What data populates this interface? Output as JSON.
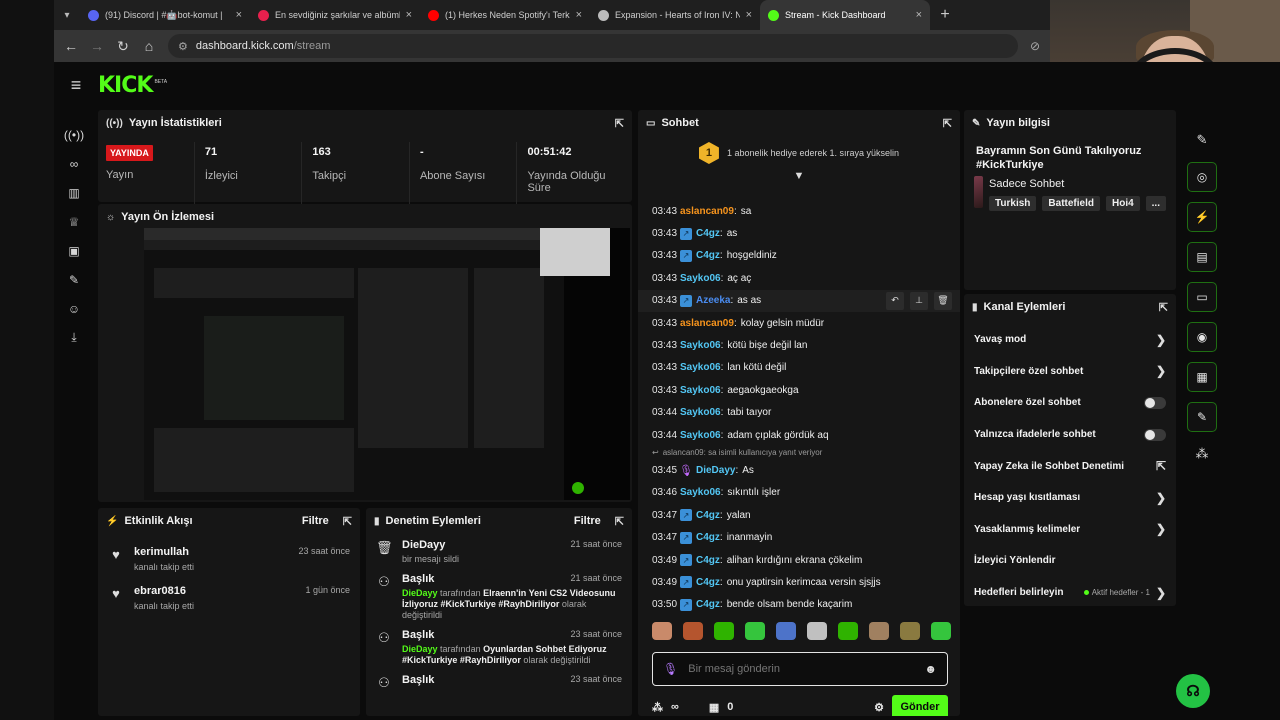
{
  "browser": {
    "tabs": [
      {
        "label": "(91) Discord | #🤖bot-komut | ",
        "color": "#5865f2",
        "active": false
      },
      {
        "label": "En sevdiğiniz şarkılar ve albümle",
        "color": "#e8204d",
        "active": false
      },
      {
        "label": "(1) Herkes Neden Spotify'ı Terk",
        "color": "#ff0000",
        "active": false
      },
      {
        "label": "Expansion - Hearts of Iron IV: N",
        "color": "#bbbbbb",
        "active": false
      },
      {
        "label": "Stream - Kick Dashboard",
        "color": "#53fc18",
        "active": true
      }
    ],
    "url_host": "dashboard.kick.com",
    "url_path": "/stream"
  },
  "app": {
    "logo": "KICK",
    "logo_badge": "BETA"
  },
  "stats_panel": {
    "title": "Yayın İstatistikleri",
    "live_badge": "YAYINDA",
    "items": [
      {
        "value": "",
        "label": "Yayın"
      },
      {
        "value": "71",
        "label": "İzleyici"
      },
      {
        "value": "163",
        "label": "Takipçi"
      },
      {
        "value": "-",
        "label": "Abone Sayısı"
      },
      {
        "value": "00:51:42",
        "label": "Yayında Olduğu Süre"
      }
    ]
  },
  "preview_panel": {
    "title": "Yayın Ön İzlemesi"
  },
  "activity_panel": {
    "title": "Etkinlik Akışı",
    "filter": "Filtre",
    "items": [
      {
        "name": "kerimullah",
        "time": "23 saat önce",
        "desc": "kanalı takip etti"
      },
      {
        "name": "ebrar0816",
        "time": "1 gün önce",
        "desc": "kanalı takip etti"
      }
    ]
  },
  "mod_panel": {
    "title": "Denetim Eylemleri",
    "filter": "Filtre",
    "items": [
      {
        "name": "DieDayy",
        "time": "21 saat önce",
        "desc": "bir mesajı sildi",
        "actor": "",
        "by": "",
        "value": "",
        "tail": ""
      },
      {
        "name": "Başlık",
        "time": "21 saat önce",
        "desc": "",
        "actor": "DieDayy",
        "by": "tarafından",
        "value": "Elraenn'in Yeni CS2 Videosunu İzliyoruz #KickTurkiye #RayhDiriliyor",
        "tail": "olarak değiştirildi"
      },
      {
        "name": "Başlık",
        "time": "23 saat önce",
        "desc": "",
        "actor": "DieDayy",
        "by": "tarafından",
        "value": "Oyunlardan Sohbet Ediyoruz #KickTurkiye #RayhDiriliyor",
        "tail": "olarak değiştirildi"
      },
      {
        "name": "Başlık",
        "time": "23 saat önce",
        "desc": "",
        "actor": "",
        "by": "",
        "value": "",
        "tail": ""
      }
    ]
  },
  "chat_panel": {
    "title": "Sohbet",
    "pinned_rank": "1",
    "pinned_text": "1 abonelik hediye ederek 1. sıraya yükselin",
    "messages": [
      {
        "time": "03:43",
        "user": "aslancan09",
        "color": "#f7941d",
        "text": "sa",
        "badge": false
      },
      {
        "time": "03:43",
        "user": "C4gz",
        "color": "#53c7f5",
        "text": "as",
        "badge": true
      },
      {
        "time": "03:43",
        "user": "C4gz",
        "color": "#53c7f5",
        "text": "hoşgeldiniz",
        "badge": true
      },
      {
        "time": "03:43",
        "user": "Sayko06",
        "color": "#53c7f5",
        "text": "aç aç",
        "badge": false
      },
      {
        "time": "03:43",
        "user": "Azeeka",
        "color": "#4a8cf0",
        "text": "as as",
        "badge": true,
        "hover": true
      },
      {
        "time": "03:43",
        "user": "aslancan09",
        "color": "#f7941d",
        "text": "kolay gelsin müdür",
        "badge": false
      },
      {
        "time": "03:43",
        "user": "Sayko06",
        "color": "#53c7f5",
        "text": "kötü bişe değil lan",
        "badge": false
      },
      {
        "time": "03:43",
        "user": "Sayko06",
        "color": "#53c7f5",
        "text": "lan kötü değil",
        "badge": false
      },
      {
        "time": "03:43",
        "user": "Sayko06",
        "color": "#53c7f5",
        "text": "aegaokgaeokga",
        "badge": false
      },
      {
        "time": "03:44",
        "user": "Sayko06",
        "color": "#53c7f5",
        "text": "tabi taıyor",
        "badge": false
      },
      {
        "time": "03:44",
        "user": "Sayko06",
        "color": "#53c7f5",
        "text": "adam çıplak gördük aq",
        "badge": false
      },
      {
        "time": "03:45",
        "user": "DieDayy",
        "color": "#53c7f5",
        "text": "As",
        "badge": "mod",
        "reply": "aslancan09: sa isimli kullanıcıya yanıt veriyor"
      },
      {
        "time": "03:46",
        "user": "Sayko06",
        "color": "#53c7f5",
        "text": "sıkıntılı işler",
        "badge": false
      },
      {
        "time": "03:47",
        "user": "C4gz",
        "color": "#53c7f5",
        "text": "yalan",
        "badge": true
      },
      {
        "time": "03:47",
        "user": "C4gz",
        "color": "#53c7f5",
        "text": "inanmayin",
        "badge": true
      },
      {
        "time": "03:49",
        "user": "C4gz",
        "color": "#53c7f5",
        "text": "alihan kırdığını ekrana çökelim",
        "badge": true
      },
      {
        "time": "03:49",
        "user": "C4gz",
        "color": "#53c7f5",
        "text": "onu yaptirsin kerimcaa versin sjsjjs",
        "badge": true
      },
      {
        "time": "03:50",
        "user": "C4gz",
        "color": "#53c7f5",
        "text": "bende olsam bende kaçarim",
        "badge": true
      }
    ],
    "emote_colors": [
      "#c98a6a",
      "#b5552e",
      "#2fb300",
      "#35c53d",
      "#4d73c9",
      "#c0c0c0",
      "#2fb300",
      "#a08060",
      "#8a7a40",
      "#35c53d"
    ],
    "input_placeholder": "Bir mesaj gönderin",
    "viewers_icon_text": "∞",
    "points": "0",
    "send_label": "Gönder"
  },
  "info_panel": {
    "title": "Yayın bilgisi",
    "stream_title": "Bayramın Son Günü Takılıyoruz #KickTurkiye",
    "category": "Sadece Sohbet",
    "tags": [
      "Turkish",
      "Battefield",
      "Hoi4",
      "..."
    ]
  },
  "actions_panel": {
    "title": "Kanal Eylemleri",
    "rows": [
      {
        "label": "Yavaş mod",
        "control": "chevron"
      },
      {
        "label": "Takipçilere özel sohbet",
        "control": "chevron"
      },
      {
        "label": "Abonelere özel sohbet",
        "control": "toggle"
      },
      {
        "label": "Yalnızca ifadelerle sohbet",
        "control": "toggle"
      },
      {
        "label": "Yapay Zeka ile Sohbet Denetimi",
        "control": "external"
      },
      {
        "label": "Hesap yaşı kısıtlaması",
        "control": "chevron"
      },
      {
        "label": "Yasaklanmış kelimeler",
        "control": "chevron"
      },
      {
        "label": "İzleyici Yönlendir",
        "control": "none"
      },
      {
        "label": "Hedefleri belirleyin",
        "control": "goals",
        "extra": "Aktif hedefler - 1"
      }
    ]
  }
}
